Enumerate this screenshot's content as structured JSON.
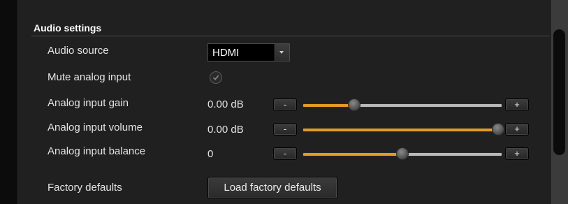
{
  "audio_settings": {
    "title": "Audio settings",
    "audio_source": {
      "label": "Audio source",
      "selected": "HDMI"
    },
    "mute_analog_input": {
      "label": "Mute analog input",
      "checked": true
    },
    "analog_input_gain": {
      "label": "Analog input gain",
      "value_text": "0.00 dB",
      "decrement_label": "-",
      "increment_label": "+",
      "level": 0.26
    },
    "analog_input_volume": {
      "label": "Analog input volume",
      "value_text": "0.00 dB",
      "decrement_label": "-",
      "increment_label": "+",
      "level": 0.98
    },
    "analog_input_balance": {
      "label": "Analog input balance",
      "value_text": "0",
      "decrement_label": "-",
      "increment_label": "+",
      "level": 0.5
    },
    "factory_defaults": {
      "label": "Factory defaults",
      "button_label": "Load factory defaults"
    }
  },
  "colors": {
    "accent": "#e59b1e",
    "panel_background": "#202020"
  },
  "icons": {
    "dropdown": "chevron-down-icon",
    "checkbox": "check-icon"
  }
}
